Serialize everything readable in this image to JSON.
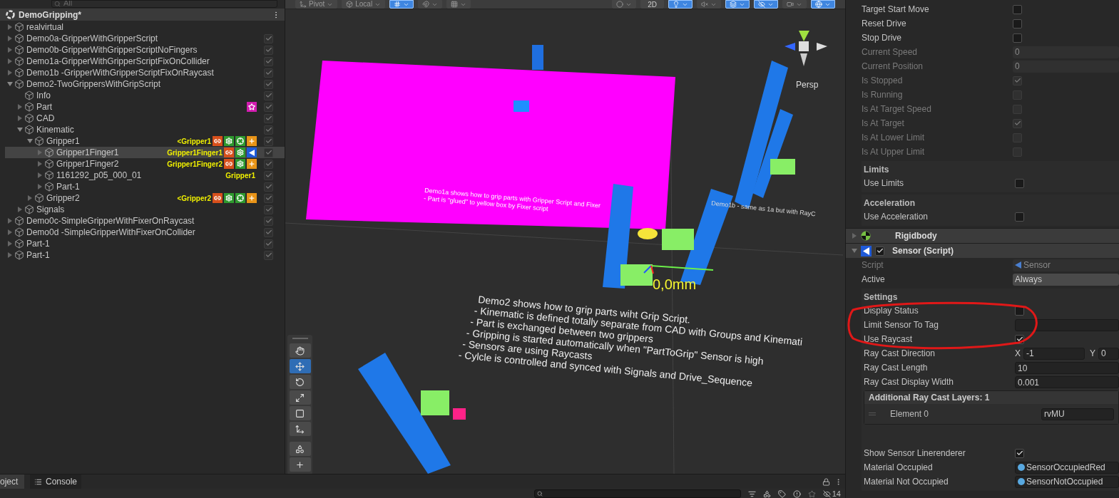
{
  "hierarchy": {
    "search": {
      "placeholder": "All"
    },
    "scene": {
      "title": "DemoGripping*"
    },
    "items": [
      {
        "name": "realvirtual",
        "expanded": false,
        "selected": false
      },
      {
        "name": "Demo0a-GripperWithGripperScript",
        "expanded": false,
        "selected": false,
        "checked": true
      },
      {
        "name": "Demo0b-GripperWithGripperScriptNoFingers",
        "expanded": false,
        "selected": false,
        "checked": true
      },
      {
        "name": "Demo1a-GripperWithGripperScriptFixOnCollider",
        "expanded": false,
        "selected": false,
        "checked": true
      },
      {
        "name": "Demo1b -GripperWithGripperScriptFixOnRaycast",
        "expanded": false,
        "selected": false,
        "checked": true
      },
      {
        "name": "Demo2-TwoGrippersWithGripScript",
        "expanded": true,
        "selected": false,
        "checked": true,
        "children": [
          {
            "name": "Info",
            "selected": false,
            "checked": true
          },
          {
            "name": "Part",
            "expanded": false,
            "selected": false,
            "checked": true,
            "badges": [
              {
                "kind": "star"
              }
            ]
          },
          {
            "name": "CAD",
            "expanded": false,
            "selected": false,
            "checked": true
          },
          {
            "name": "Kinematic",
            "expanded": true,
            "selected": false,
            "checked": true,
            "children": [
              {
                "name": "Gripper1",
                "expanded": true,
                "selected": false,
                "checked": true,
                "tag": "<Gripper1",
                "badges": [
                  {
                    "kind": "link"
                  },
                  {
                    "kind": "gear"
                  },
                  {
                    "kind": "target"
                  },
                  {
                    "kind": "plus"
                  }
                ],
                "children": [
                  {
                    "name": "Gripper1Finger1",
                    "expanded": false,
                    "selected": true,
                    "checked": true,
                    "tag": "Gripper1Finger1",
                    "badges": [
                      {
                        "kind": "link"
                      },
                      {
                        "kind": "gear"
                      },
                      {
                        "kind": "sensor"
                      }
                    ]
                  },
                  {
                    "name": "Gripper1Finger2",
                    "expanded": false,
                    "selected": false,
                    "checked": true,
                    "tag": "Gripper1Finger2",
                    "badges": [
                      {
                        "kind": "link"
                      },
                      {
                        "kind": "gear"
                      },
                      {
                        "kind": "plus"
                      }
                    ]
                  },
                  {
                    "name": "1161292_p05_000_01",
                    "expanded": false,
                    "selected": false,
                    "checked": true,
                    "tag": "Gripper1"
                  },
                  {
                    "name": "Part-1",
                    "expanded": false,
                    "selected": false,
                    "checked": true
                  }
                ]
              },
              {
                "name": "Gripper2",
                "expanded": false,
                "selected": false,
                "checked": true,
                "tag": "<Gripper2",
                "badges": [
                  {
                    "kind": "link"
                  },
                  {
                    "kind": "gear"
                  },
                  {
                    "kind": "target"
                  },
                  {
                    "kind": "plus"
                  }
                ]
              }
            ]
          },
          {
            "name": "Signals",
            "expanded": false,
            "selected": false,
            "checked": true
          }
        ]
      },
      {
        "name": "Demo0c-SimpleGripperWithFixerOnRaycast",
        "expanded": false,
        "selected": false,
        "checked": true
      },
      {
        "name": "Demo0d -SimpleGripperWithFixerOnCollider",
        "expanded": false,
        "selected": false,
        "checked": true
      },
      {
        "name": "Part-1",
        "expanded": false,
        "selected": false,
        "checked": true
      },
      {
        "name": "Part-1",
        "expanded": false,
        "selected": false,
        "checked": true
      }
    ]
  },
  "scene_toolbar": [
    {
      "kind": "dropdown",
      "label": "Pivot",
      "selected": false
    },
    {
      "kind": "dropdown",
      "label": "Local",
      "selected": false
    },
    {
      "kind": "icon",
      "selected": true
    },
    {
      "kind": "icon",
      "selected": false
    },
    {
      "kind": "icon",
      "selected": false
    },
    {
      "kind": "spacer"
    },
    {
      "kind": "icon",
      "selected": false
    },
    {
      "kind": "text",
      "label": "2D",
      "selected": false
    },
    {
      "kind": "icon",
      "selected": true
    },
    {
      "kind": "icon",
      "selected": false
    },
    {
      "kind": "icon",
      "selected": true
    },
    {
      "kind": "icon",
      "selected": true
    },
    {
      "kind": "icon",
      "selected": false
    },
    {
      "kind": "icon",
      "selected": true
    }
  ],
  "scene": {
    "projection": "Persp",
    "measure": "0,0mm",
    "note_demo1a": [
      "Demo1a shows how to grip parts with Gripper Script and Fixer",
      "- Part is \"glued\" to yellow box by Fixer script"
    ],
    "note_demo1b": "Demo1b - same as 1a but with RayC",
    "note_demo2": [
      "Demo2 shows how to grip parts wiht Grip Script.",
      "- Kinematic is defined totally separate from CAD with Groups and Kinemati",
      "- Part is exchanged between two grippers",
      "- Gripping is started automatically when \"PartToGrip\" Sensor is high",
      "- Sensors are using Raycasts",
      "- Cylcle is controlled and synced with Signals and Drive_Sequence"
    ],
    "tools": [
      {
        "selected": false
      },
      {
        "selected": true
      },
      {
        "selected": false
      },
      {
        "selected": false
      },
      {
        "selected": false
      },
      {
        "selected": false
      },
      {
        "selected": false
      },
      {
        "selected": false
      }
    ]
  },
  "inspector": [
    {
      "kind": "checkbox",
      "label": "Target Start Move",
      "checked": false,
      "disabled": false
    },
    {
      "kind": "checkbox",
      "label": "Reset Drive",
      "checked": false,
      "disabled": false
    },
    {
      "kind": "checkbox",
      "label": "Stop Drive",
      "checked": false,
      "disabled": false
    },
    {
      "kind": "field",
      "label": "Current Speed",
      "value": "0",
      "disabled": true
    },
    {
      "kind": "field",
      "label": "Current Position",
      "value": "0",
      "disabled": true
    },
    {
      "kind": "checkbox",
      "label": "Is Stopped",
      "checked": true,
      "disabled": true
    },
    {
      "kind": "checkbox",
      "label": "Is Running",
      "checked": false,
      "disabled": true
    },
    {
      "kind": "checkbox",
      "label": "Is At Target Speed",
      "checked": false,
      "disabled": true
    },
    {
      "kind": "checkbox",
      "label": "Is At Target",
      "checked": true,
      "disabled": true
    },
    {
      "kind": "checkbox",
      "label": "Is At Lower Limit",
      "checked": false,
      "disabled": true
    },
    {
      "kind": "checkbox",
      "label": "Is At Upper Limit",
      "checked": false,
      "disabled": true
    },
    {
      "kind": "group",
      "title": "Limits",
      "rows": [
        {
          "kind": "checkbox",
          "label": "Use Limits",
          "checked": false,
          "disabled": false
        }
      ]
    },
    {
      "kind": "group",
      "title": "Acceleration",
      "rows": [
        {
          "kind": "checkbox",
          "label": "Use Acceleration",
          "checked": false,
          "disabled": false
        }
      ]
    },
    {
      "kind": "rigidbody",
      "title": "Rigidbody",
      "expanded": false
    },
    {
      "kind": "script",
      "title": "Sensor (Script)",
      "expanded": true,
      "enabled": true
    },
    {
      "kind": "script_ref",
      "label": "Script",
      "value": "Sensor",
      "disabled": true
    },
    {
      "kind": "dropdown",
      "label": "Active",
      "value": "Always",
      "disabled": false
    },
    {
      "kind": "group",
      "title": "Settings",
      "rows": [
        {
          "kind": "checkbox",
          "label": "Display Status",
          "checked": false,
          "disabled": false
        },
        {
          "kind": "field",
          "label": "Limit Sensor To Tag",
          "disabled": false
        },
        {
          "kind": "checkbox",
          "label": "Use Raycast",
          "checked": true,
          "disabled": false
        },
        {
          "kind": "vector",
          "label": "Ray Cast Direction",
          "axes": [
            {
              "label": "X",
              "value": "-1"
            },
            {
              "label": "Y",
              "value": "0"
            }
          ],
          "disabled": false
        },
        {
          "kind": "field",
          "label": "Ray Cast Length",
          "value": "10",
          "disabled": false
        },
        {
          "kind": "field",
          "label": "Ray Cast Display Width",
          "value": "0.001",
          "disabled": false
        },
        {
          "kind": "list",
          "title": "Additional Ray Cast Layers: 1",
          "elements": [
            {
              "label": "Element 0",
              "value": "rvMU"
            }
          ]
        },
        {
          "kind": "checkbox",
          "label": "Show Sensor Linerenderer",
          "checked": true,
          "disabled": false
        },
        {
          "kind": "material",
          "label": "Material Occupied",
          "value": "SensorOccupiedRed",
          "disabled": false
        },
        {
          "kind": "material",
          "label": "Material Not Occupied",
          "value": "SensorNotOccupied",
          "disabled": false
        }
      ]
    }
  ],
  "bottom_tabs": [
    {
      "label": "oject",
      "selected": true
    },
    {
      "label": "Console",
      "selected": false
    }
  ],
  "hidden_count": "14"
}
